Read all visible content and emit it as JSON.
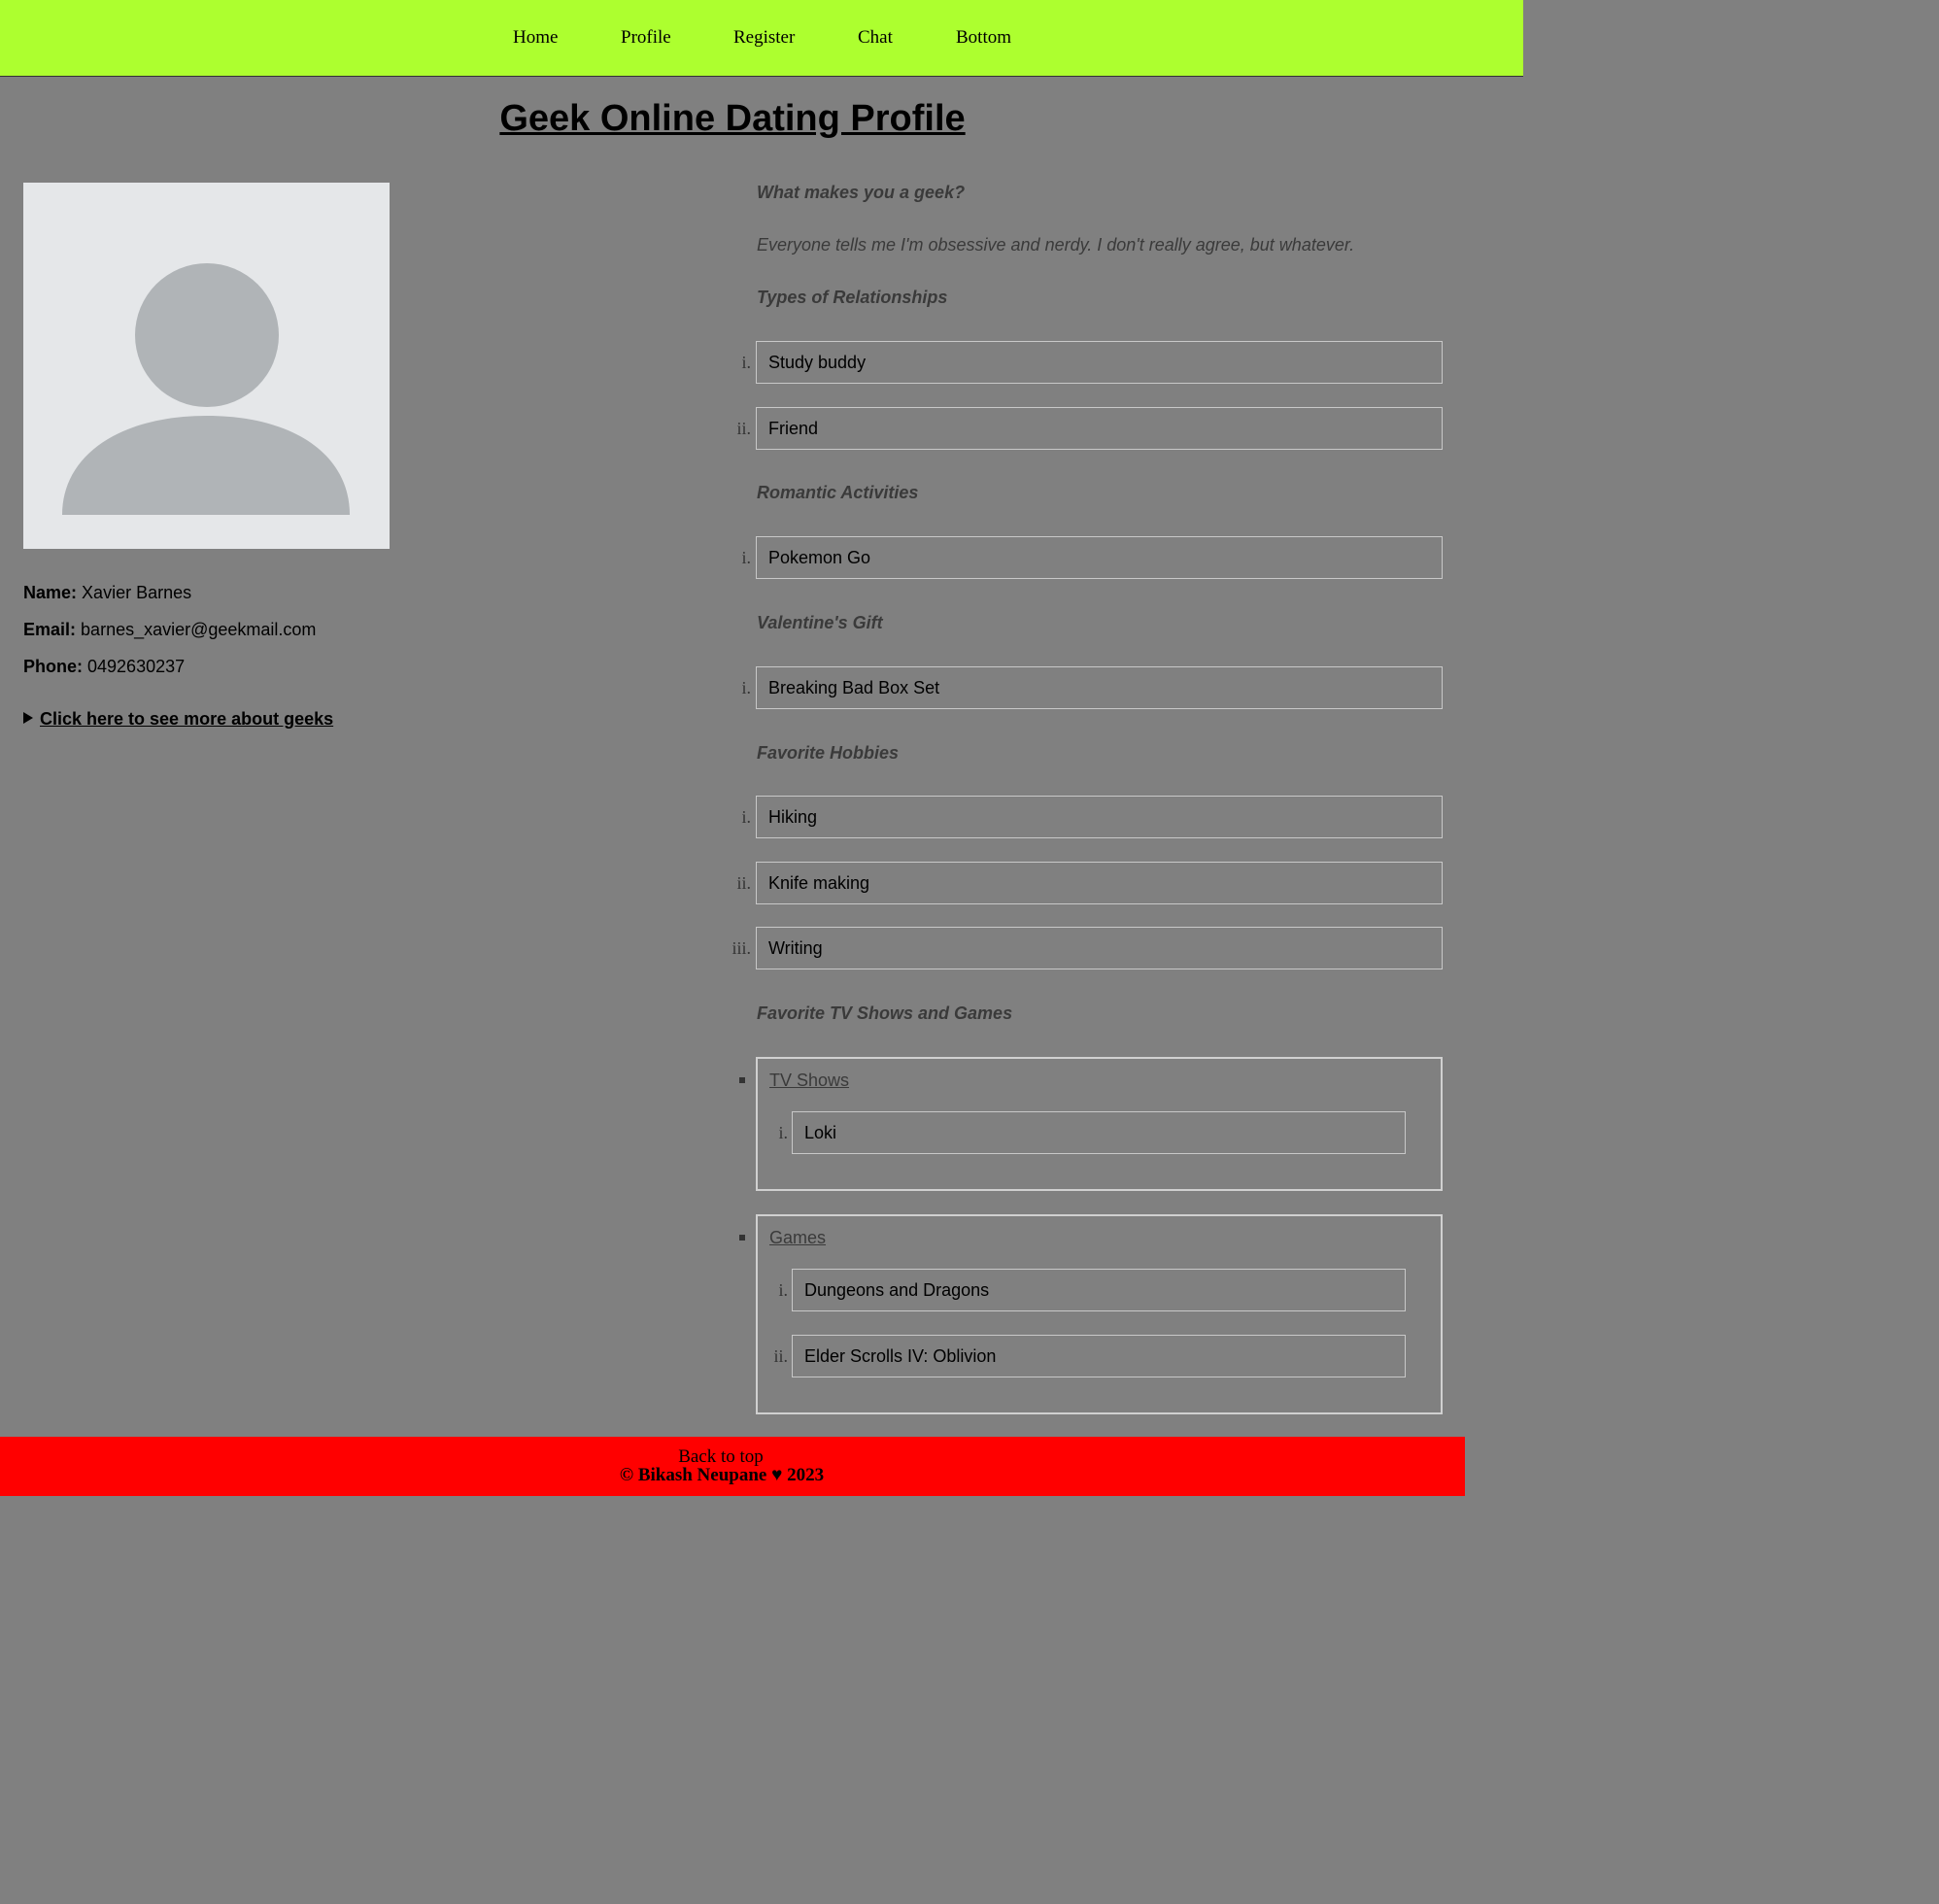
{
  "nav": {
    "home": "Home",
    "profile": "Profile",
    "register": "Register",
    "chat": "Chat",
    "bottom": "Bottom"
  },
  "title": "Geek Online Dating Profile",
  "profile": {
    "name_label": "Name:",
    "name": "Xavier Barnes",
    "email_label": "Email:",
    "email": "barnes_xavier@geekmail.com",
    "phone_label": "Phone:",
    "phone": "0492630237",
    "details_summary": "Click here to see more about geeks"
  },
  "questions": {
    "geek_heading": "What makes you a geek?",
    "geek_answer": "Everyone tells me I'm obsessive and nerdy. I don't really agree, but whatever.",
    "relationships_heading": "Types of Relationships",
    "relationships": [
      "Study buddy",
      "Friend"
    ],
    "romantic_heading": "Romantic Activities",
    "romantic": [
      "Pokemon Go"
    ],
    "valentine_heading": "Valentine's Gift",
    "valentine": [
      "Breaking Bad Box Set"
    ],
    "hobbies_heading": "Favorite Hobbies",
    "hobbies": [
      "Hiking",
      "Knife making",
      "Writing"
    ],
    "tv_games_heading": "Favorite TV Shows and Games",
    "tv_label": "TV Shows",
    "tv": [
      "Loki"
    ],
    "games_label": "Games",
    "games": [
      "Dungeons and Dragons",
      "Elder Scrolls IV: Oblivion"
    ]
  },
  "markers": [
    "i.",
    "ii.",
    "iii."
  ],
  "footer": {
    "back_to_top": "Back to top",
    "copyright": "© Bikash Neupane ♥ 2023"
  },
  "colors": {
    "nav_bg": "#adff2f",
    "page_bg": "#808080",
    "footer_bg": "#ff0000",
    "avatar_bg": "#e5e7e9",
    "avatar_fg": "#b0b4b7"
  },
  "icons": {
    "avatar": "user-silhouette-icon",
    "details": "triangle-right-icon",
    "list_bullet": "square-bullet-icon"
  }
}
